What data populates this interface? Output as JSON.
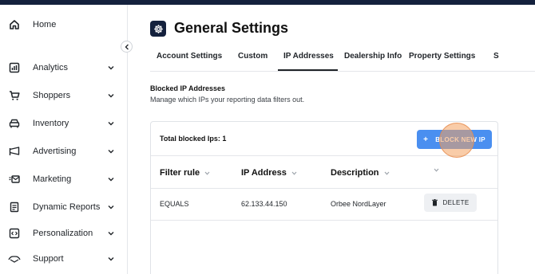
{
  "sidebar": {
    "items": [
      {
        "label": "Home",
        "icon": "home-icon",
        "has_chevron": false
      },
      {
        "label": "Analytics",
        "icon": "analytics-icon",
        "has_chevron": true
      },
      {
        "label": "Shoppers",
        "icon": "cart-icon",
        "has_chevron": true
      },
      {
        "label": "Inventory",
        "icon": "car-icon",
        "has_chevron": true
      },
      {
        "label": "Advertising",
        "icon": "megaphone-icon",
        "has_chevron": true
      },
      {
        "label": "Marketing",
        "icon": "mail-icon",
        "has_chevron": true
      },
      {
        "label": "Dynamic Reports",
        "icon": "report-icon",
        "has_chevron": true
      },
      {
        "label": "Personalization",
        "icon": "code-icon",
        "has_chevron": true
      },
      {
        "label": "Support",
        "icon": "support-icon",
        "has_chevron": true
      }
    ]
  },
  "header": {
    "title": "General Settings",
    "icon": "gear-icon"
  },
  "tabs": [
    {
      "label": "Account Settings",
      "active": false
    },
    {
      "label": "Custom",
      "active": false
    },
    {
      "label": "IP Addresses",
      "active": true
    },
    {
      "label": "Dealership Info",
      "active": false
    },
    {
      "label": "Property Settings",
      "active": false
    },
    {
      "label": "S",
      "active": false
    }
  ],
  "section": {
    "title": "Blocked IP Addresses",
    "description": "Manage which IPs your reporting data filters out."
  },
  "card": {
    "total_label": "Total blocked Ips: 1",
    "block_button_plus": "+",
    "block_button_label": "BLOCK NEW IP",
    "columns": [
      "Filter rule",
      "IP Address",
      "Description",
      ""
    ],
    "rows": [
      {
        "filter_rule": "EQUALS",
        "ip_address": "62.133.44.150",
        "description": "Orbee NordLayer",
        "action": "DELETE"
      }
    ]
  },
  "colors": {
    "accent": "#4a8ff0",
    "topbar": "#14213d",
    "click_highlight": "#f4a261"
  }
}
